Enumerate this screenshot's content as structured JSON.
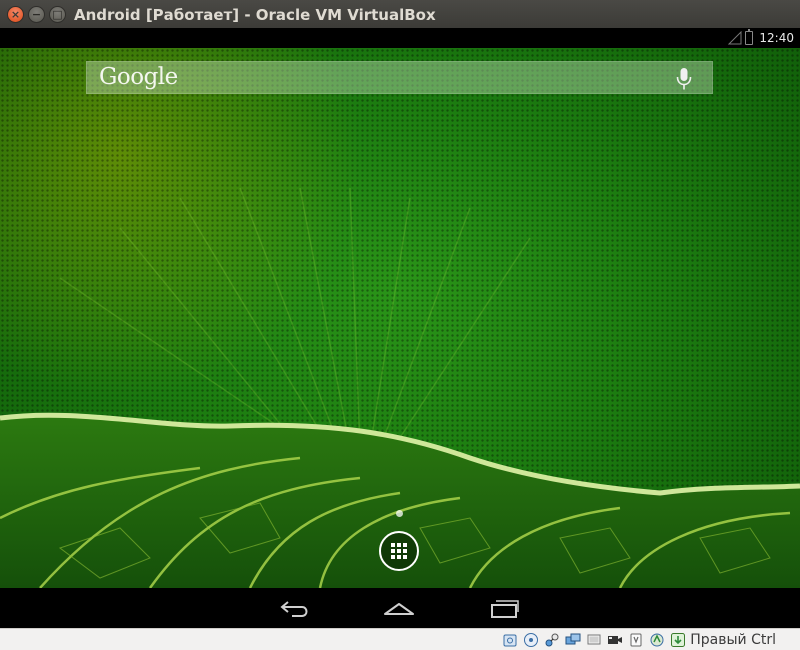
{
  "window": {
    "title": "Android [Работает] - Oracle VM VirtualBox",
    "close_glyph": "×",
    "minimize_glyph": "−",
    "maximize_glyph": "□"
  },
  "android": {
    "status_bar": {
      "time": "12:40",
      "icons": [
        "signal-icon",
        "battery-icon"
      ]
    },
    "search_widget": {
      "logo_text": "Google",
      "mic_icon": "mic-icon"
    },
    "home": {
      "page_indicator_count": 1,
      "apps_icon": "all-apps-icon"
    },
    "nav_bar": {
      "buttons": [
        "back-icon",
        "home-icon",
        "recent-apps-icon"
      ]
    }
  },
  "vbox_statusbar": {
    "icons": [
      "hard-disk-icon",
      "optical-drive-icon",
      "network-icon",
      "shared-folders-icon",
      "display-icon",
      "video-capture-icon",
      "usb-icon",
      "mouse-integration-icon",
      "host-key-icon"
    ],
    "host_key_label": "Правый Ctrl"
  },
  "colors": {
    "title_bar": "#3c3b37",
    "close_button": "#df4a16",
    "wallpaper_green": "#1c7c10",
    "android_bars": "#000000"
  }
}
